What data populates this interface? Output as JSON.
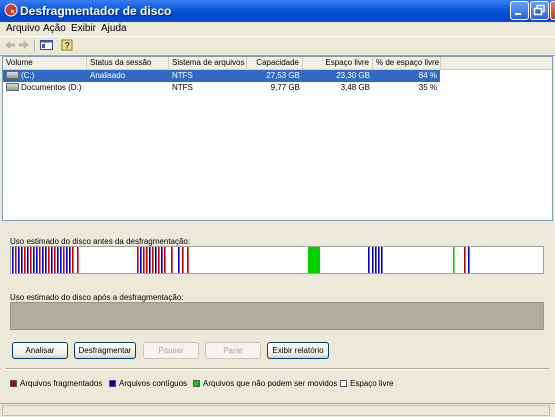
{
  "window": {
    "title": "Desfragmentador de disco"
  },
  "menu": [
    "Arquivo",
    "Ação",
    "Exibir",
    "Ajuda"
  ],
  "columns": [
    "Volume",
    "Status da sessão",
    "Sistema de arquivos",
    "Capacidade",
    "Espaço livre",
    "% de espaço livre"
  ],
  "volumes": [
    {
      "volume": "(C:)",
      "status": "Analisado",
      "fs": "NTFS",
      "capacity": "27,53 GB",
      "free": "23,30 GB",
      "pct": "84 %"
    },
    {
      "volume": "Documentos (D:)",
      "status": "",
      "fs": "NTFS",
      "capacity": "9,77 GB",
      "free": "3,48 GB",
      "pct": "35 %"
    }
  ],
  "before_label": "Uso estimado do disco antes da desfragmentação:",
  "after_label": "Uso estimado do disco após a desfragmentação:",
  "buttons": {
    "analyze": "Analisar",
    "defrag": "Desfragmentar",
    "pause": "Pausar",
    "stop": "Parar",
    "report": "Exibir relatório"
  },
  "legend": {
    "fragmented": "Arquivos fragmentados",
    "contiguous": "Arquivos contíguos",
    "unmovable": "Arquivos que não podem ser movidos",
    "free": "Espaço livre"
  },
  "colors": {
    "fragmented": "#c00000",
    "contiguous": "#0000c0",
    "unmovable": "#00d000",
    "free": "#ffffff",
    "selection": "#316ac5"
  }
}
